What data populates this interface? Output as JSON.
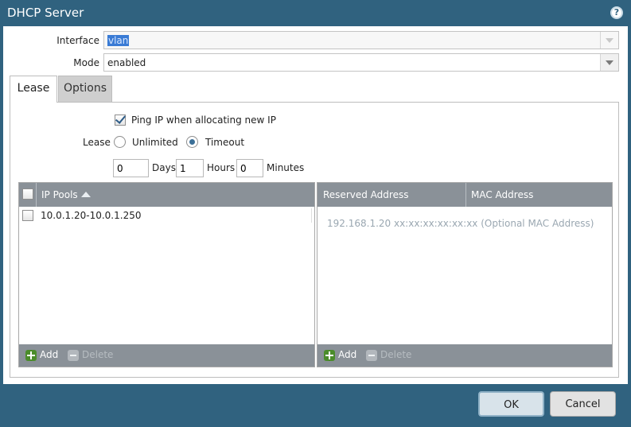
{
  "dialog": {
    "title": "DHCP Server",
    "help_icon": "question-circle-icon",
    "help_glyph": "?"
  },
  "form": {
    "interface_label": "Interface",
    "interface_value": "vlan",
    "mode_label": "Mode",
    "mode_value": "enabled"
  },
  "tabs": [
    {
      "label": "Lease",
      "active": true
    },
    {
      "label": "Options",
      "active": false
    }
  ],
  "lease": {
    "ping_label": "Ping IP when allocating new IP",
    "ping_checked": true,
    "lease_label": "Lease",
    "unlimited_label": "Unlimited",
    "timeout_label": "Timeout",
    "selected": "Timeout",
    "days_value": "0",
    "days_label": "Days",
    "hours_value": "1",
    "hours_label": "Hours",
    "minutes_value": "0",
    "minutes_label": "Minutes"
  },
  "ip_pools": {
    "header": "IP Pools",
    "rows": [
      "10.0.1.20-10.0.1.250"
    ],
    "add_label": "Add",
    "delete_label": "Delete"
  },
  "reserved": {
    "col_address": "Reserved Address",
    "col_mac": "MAC Address",
    "placeholder": "192.168.1.20 xx:xx:xx:xx:xx:xx (Optional MAC Address)",
    "add_label": "Add",
    "delete_label": "Delete"
  },
  "buttons": {
    "ok": "OK",
    "cancel": "Cancel"
  },
  "colors": {
    "titlebar": "#30627f",
    "grid_header": "#8a9198",
    "add_icon": "#4b8c2b"
  }
}
